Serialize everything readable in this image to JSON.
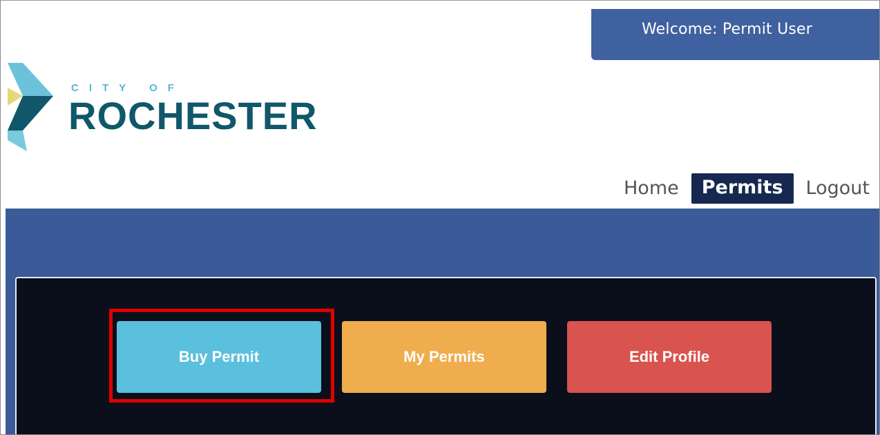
{
  "header": {
    "welcome_text": "Welcome:  Permit User"
  },
  "logo": {
    "line1": "CITY OF",
    "line2": "ROCHESTER",
    "colors": {
      "chevron_light": "#6cc3d9",
      "chevron_dark": "#10576b",
      "triangle": "#e5d77a"
    }
  },
  "nav": {
    "items": [
      {
        "label": "Home",
        "active": false
      },
      {
        "label": "Permits",
        "active": true
      },
      {
        "label": "Logout",
        "active": false
      }
    ]
  },
  "actions": {
    "buy_permit": "Buy Permit",
    "my_permits": "My Permits",
    "edit_profile": "Edit Profile"
  },
  "colors": {
    "header_blue": "#3f619f",
    "band_blue": "#3a5b97",
    "nav_active": "#16284f",
    "panel_bg": "#0b0f1b",
    "buy_btn": "#5bc0de",
    "my_btn": "#f0ad4e",
    "edit_btn": "#d9534f",
    "highlight": "#e00000"
  }
}
